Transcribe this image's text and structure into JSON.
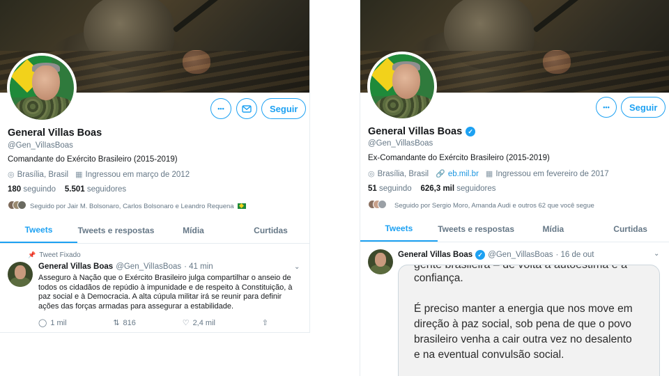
{
  "left": {
    "name": "General Villas Boas",
    "handle": "@Gen_VilIasBoas",
    "bio": "Comandante do Exército Brasileiro (2015-2019)",
    "location": "Brasília, Brasil",
    "joined": "Ingressou em março de 2012",
    "following_count": "180",
    "following_label": "seguindo",
    "followers_count": "5.501",
    "followers_label": "seguidores",
    "followed_by": "Seguido por Jair M. Bolsonaro, Carlos Bolsonaro e Leandro Requena",
    "more_label": "•••",
    "follow_label": "Seguir",
    "tabs": [
      "Tweets",
      "Tweets e respostas",
      "Mídia",
      "Curtidas"
    ],
    "pinned_label": "Tweet Fixado",
    "tweet": {
      "name": "General Villas Boas",
      "handle": "@Gen_VilIasBoas",
      "time": "· 41 min",
      "text": "Asseguro à Nação que o Exército Brasileiro julga compartilhar o anseio de todos os cidadãos de repúdio à impunidade e de respeito à Constituição, à paz social e à Democracia. A alta cúpula militar irá se reunir para definir ações das forças armadas para assegurar a estabilidade.",
      "replies": "1 mil",
      "retweets": "816",
      "likes": "2,4 mil"
    }
  },
  "right": {
    "name": "General Villas Boas",
    "handle": "@Gen_VillasBoas",
    "bio": "Ex-Comandante do Exército Brasileiro (2015-2019)",
    "location": "Brasília, Brasil",
    "link": "eb.mil.br",
    "joined": "Ingressou em fevereiro de 2017",
    "following_count": "51",
    "following_label": "seguindo",
    "followers_count": "626,3 mil",
    "followers_label": "seguidores",
    "followed_by": "Seguido por Sergio Moro, Amanda Audi e outros 62 que você segue",
    "more_label": "•••",
    "follow_label": "Seguir",
    "tabs": [
      "Tweets",
      "Tweets e respostas",
      "Mídia",
      "Curtidas"
    ],
    "tweet": {
      "name": "General Villas Boas",
      "handle": "@Gen_VillasBoas",
      "time": "· 16 de out",
      "quote_partial": "gente brasileira – de volta à autoestima e à",
      "quote_line1": "confiança.",
      "quote_line2": "É preciso manter a energia que nos move em",
      "quote_line3": "direção à paz social, sob pena de que o povo",
      "quote_line4": "brasileiro venha a cair outra vez no desalento",
      "quote_line5": "e na eventual convulsão social."
    }
  },
  "icons": {
    "location": "location-icon",
    "calendar": "calendar-icon",
    "link": "link-icon",
    "mail": "mail-icon",
    "pin": "pin-icon",
    "reply": "reply-icon",
    "retweet": "retweet-icon",
    "like": "heart-icon",
    "share": "share-icon",
    "verified": "verified-icon",
    "caret": "chevron-down-icon"
  },
  "colors": {
    "accent": "#1da1f2",
    "muted": "#657786",
    "link": "#1b95e0"
  }
}
